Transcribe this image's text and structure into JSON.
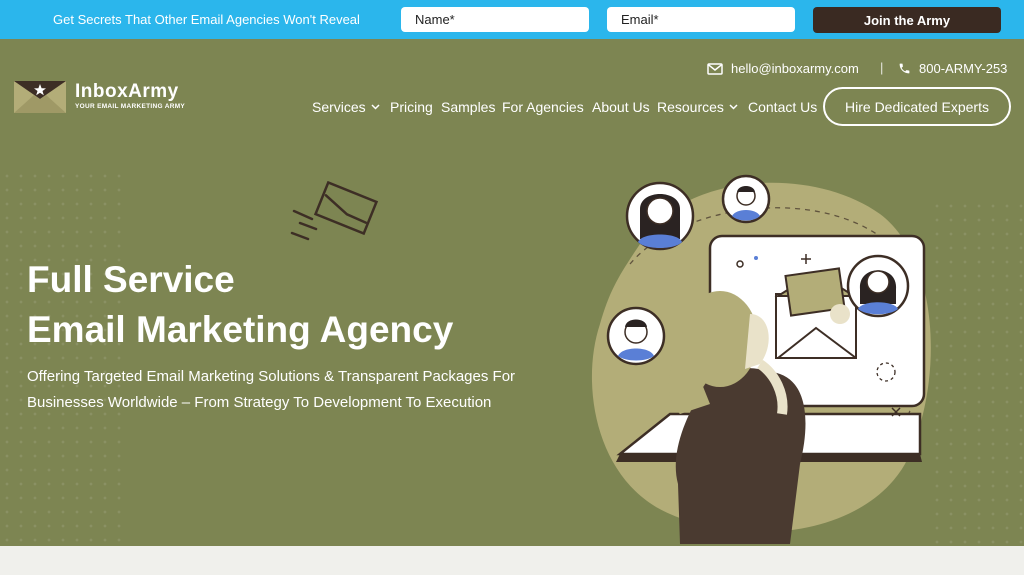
{
  "signup": {
    "text": "Get Secrets That Other Email Agencies Won't Reveal",
    "name_placeholder": "Name*",
    "email_placeholder": "Email*",
    "join_label": "Join the Army"
  },
  "brand": {
    "name": "InboxArmy",
    "tagline": "YOUR EMAIL MARKETING ARMY"
  },
  "contact": {
    "email": "hello@inboxarmy.com",
    "separator": "|",
    "phone": "800-ARMY-253"
  },
  "nav": {
    "items": [
      {
        "label": "Services",
        "has_dropdown": true
      },
      {
        "label": "Pricing",
        "has_dropdown": false
      },
      {
        "label": "Samples",
        "has_dropdown": false
      },
      {
        "label": "For Agencies",
        "has_dropdown": false
      },
      {
        "label": "About Us",
        "has_dropdown": false
      },
      {
        "label": "Resources",
        "has_dropdown": true
      },
      {
        "label": "Contact Us",
        "has_dropdown": false
      }
    ],
    "cta_label": "Hire Dedicated Experts"
  },
  "hero": {
    "title_line1": "Full Service",
    "title_line2": "Email Marketing Agency",
    "subtitle_line1": "Offering Targeted Email Marketing Solutions & Transparent Packages For",
    "subtitle_line2": "Businesses Worldwide – From Strategy To Development To Execution"
  },
  "colors": {
    "signup_bar": "#2bb6ec",
    "hero_bg": "#7d8552",
    "join_button": "#3a2a22",
    "text": "#ffffff"
  },
  "icons": {
    "email": "envelope-icon",
    "phone": "phone-icon",
    "dropdown": "chevron-down-icon"
  }
}
